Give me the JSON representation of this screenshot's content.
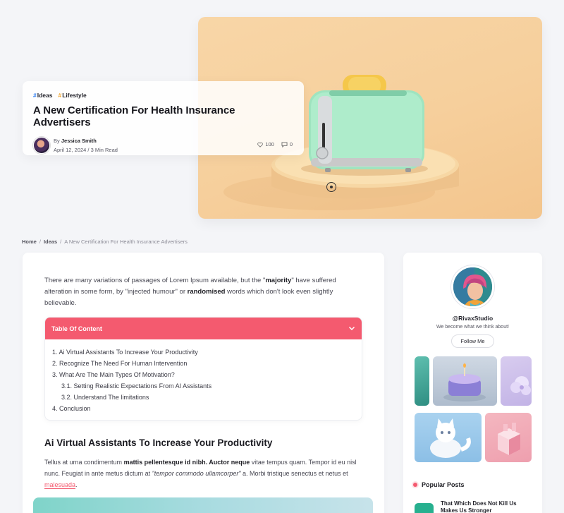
{
  "hero": {
    "tags": [
      "Ideas",
      "Lifestyle"
    ],
    "title": "A New Certification For Health Insurance Advertisers",
    "author_prefix": "By",
    "author": "Jessica Smith",
    "date": "April 12, 2024",
    "separator": "/",
    "read_time": "3 Min Read",
    "likes": "100",
    "comments": "0"
  },
  "breadcrumb": {
    "items": [
      "Home",
      "Ideas",
      "A New Certification For Health Insurance Advertisers"
    ],
    "separator": "/"
  },
  "article": {
    "intro_parts": [
      "There are many variations of passages of Lorem Ipsum available, but the \"",
      "majority",
      "\" have suffered alteration in some form, by \"injected humour\" or ",
      "randomised",
      " words which don't look even slightly believable."
    ],
    "toc": {
      "title": "Table Of Content",
      "items": [
        "1. Ai Virtual Assistants To Increase Your Productivity",
        "2. Recognize The Need For Human Intervention",
        "3. What Are The Main Types Of Motivation?",
        "3.1. Setting Realistic Expectations From AI Assistants",
        "3.2. Understand The limitations",
        "4. Conclusion"
      ]
    },
    "section_heading": "Ai Virtual Assistants To Increase Your Productivity",
    "section_parts": [
      "Tellus at urna condimentum ",
      "mattis pellentesque id nibh. Auctor neque",
      " vitae tempus quam. Tempor id eu nisl nunc. Feugiat in ante metus dictum at ",
      "\"tempor commodo ullamcorper\"",
      " a. Morbi tristique senectus et netus et ",
      "malesuada",
      "."
    ]
  },
  "sidebar": {
    "profile_name": "@RivaxStudio",
    "profile_bio": "We become what we think about!",
    "follow_label": "Follow Me",
    "popular_title": "Popular Posts",
    "popular_posts": [
      "That Which Does Not Kill Us Makes Us Stronger"
    ]
  },
  "colors": {
    "accent": "#f45a6f",
    "tag_ideas": "#2d7cf0",
    "tag_lifestyle": "#f0a020",
    "hero_bg": "#f6cf9c"
  },
  "icons": [
    "heart-icon",
    "comment-icon",
    "chevron-down-icon",
    "play-icon"
  ]
}
